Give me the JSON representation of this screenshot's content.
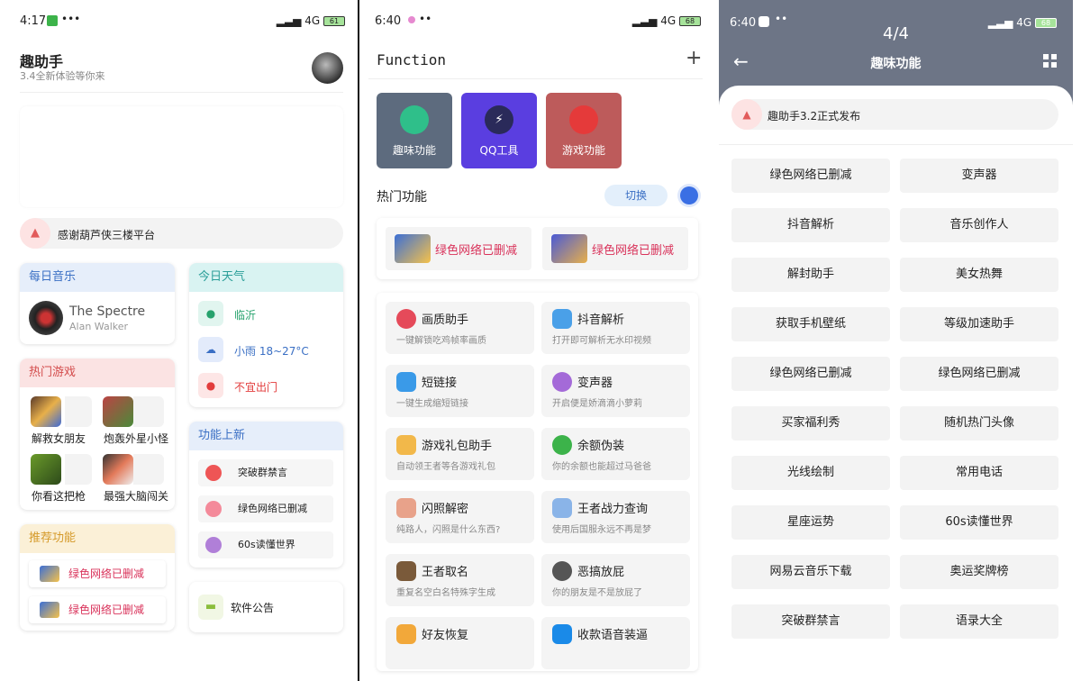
{
  "screen1": {
    "status": {
      "time": "4:17",
      "dots": "•••",
      "signal": "4G",
      "battery": "61"
    },
    "app_title": "趣助手",
    "app_subtitle": "3.4全新体验等你来",
    "notice": "感谢葫芦侠三楼平台",
    "music": {
      "header": "每日音乐",
      "song": "The Spectre",
      "artist": "Alan Walker"
    },
    "weather": {
      "header": "今日天气",
      "city": "临沂",
      "condition": "小雨 18~27°C",
      "advice": "不宜出门"
    },
    "games": {
      "header": "热门游戏",
      "items": [
        "解救女朋友",
        "炮轰外星小怪",
        "你看这把枪",
        "最强大脑闯关"
      ]
    },
    "new_features": {
      "header": "功能上新",
      "items": [
        "突破群禁言",
        "绿色网络已删减",
        "60s读懂世界"
      ]
    },
    "recommend": {
      "header": "推荐功能",
      "items": [
        "绿色网络已删减",
        "绿色网络已删减"
      ]
    },
    "announcement": "软件公告"
  },
  "screen2": {
    "status": {
      "time": "6:40",
      "dots": "••",
      "signal": "4G",
      "battery": "68"
    },
    "title": "Function",
    "add": "+",
    "categories": [
      "趣味功能",
      "QQ工具",
      "游戏功能"
    ],
    "hot_label": "热门功能",
    "switch_label": "切换",
    "banners": [
      "绿色网络已删减",
      "绿色网络已删减"
    ],
    "features": [
      {
        "title": "画质助手",
        "desc": "一键解锁吃鸡帧率画质"
      },
      {
        "title": "抖音解析",
        "desc": "打开即可解析无水印视频"
      },
      {
        "title": "短链接",
        "desc": "一键生成缩短链接"
      },
      {
        "title": "变声器",
        "desc": "开启便是娇滴滴小萝莉"
      },
      {
        "title": "游戏礼包助手",
        "desc": "自动领王者等各游戏礼包"
      },
      {
        "title": "余额伪装",
        "desc": "你的余额也能超过马爸爸"
      },
      {
        "title": "闪照解密",
        "desc": "纯路人，闪照是什么东西?"
      },
      {
        "title": "王者战力查询",
        "desc": "使用后国服永远不再是梦"
      },
      {
        "title": "王者取名",
        "desc": "重复名空白名特殊字生成"
      },
      {
        "title": "恶搞放屁",
        "desc": "你的朋友是不是放屁了"
      },
      {
        "title": "好友恢复",
        "desc": ""
      },
      {
        "title": "收款语音装逼",
        "desc": ""
      }
    ]
  },
  "screen3": {
    "status": {
      "time": "6:40",
      "dots": "••",
      "signal": "4G",
      "battery": "68"
    },
    "page_indicator": "4/4",
    "title": "趣味功能",
    "notice": "趣助手3.2正式发布",
    "buttons": [
      "绿色网络已删减",
      "变声器",
      "抖音解析",
      "音乐创作人",
      "解封助手",
      "美女热舞",
      "获取手机壁纸",
      "等级加速助手",
      "绿色网络已删减",
      "绿色网络已删减",
      "买家福利秀",
      "随机热门头像",
      "光线绘制",
      "常用电话",
      "星座运势",
      "60s读懂世界",
      "网易云音乐下载",
      "奥运奖牌榜",
      "突破群禁言",
      "语录大全"
    ]
  }
}
